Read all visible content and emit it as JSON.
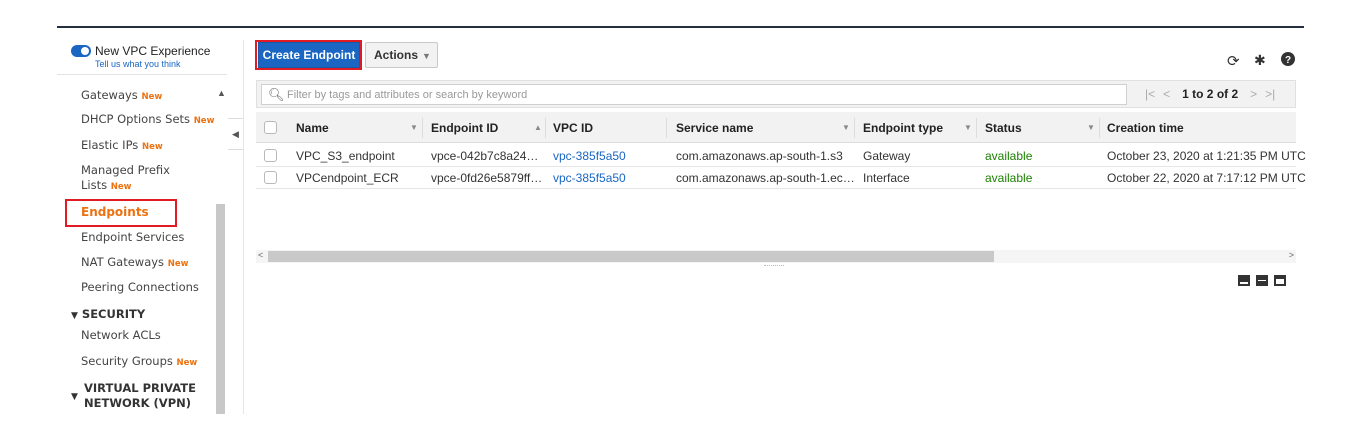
{
  "sidebar": {
    "vpc_experience": {
      "title": "New VPC Experience",
      "link": "Tell us what you think"
    },
    "items": [
      {
        "label": "Gateways",
        "badge": "New"
      },
      {
        "label": "DHCP Options Sets",
        "badge": "New"
      },
      {
        "label": "Elastic IPs",
        "badge": "New"
      },
      {
        "label": "Managed Prefix",
        "label2": "Lists",
        "badge": "New"
      },
      {
        "label": "Endpoints",
        "badge": ""
      },
      {
        "label": "Endpoint Services",
        "badge": ""
      },
      {
        "label": "NAT Gateways",
        "badge": "New"
      },
      {
        "label": "Peering Connections",
        "badge": ""
      }
    ],
    "sections": [
      {
        "label": "SECURITY",
        "items": [
          {
            "label": "Network ACLs",
            "badge": ""
          },
          {
            "label": "Security Groups",
            "badge": "New"
          }
        ]
      },
      {
        "label": "VIRTUAL PRIVATE",
        "label2": "NETWORK (VPN)"
      }
    ]
  },
  "toolbar": {
    "create_label": "Create Endpoint",
    "actions_label": "Actions",
    "icons": [
      "refresh-icon",
      "gear-icon",
      "help-icon"
    ]
  },
  "filter": {
    "placeholder": "Filter by tags and attributes or search by keyword",
    "pager": "1 to 2 of 2"
  },
  "table": {
    "columns": [
      "Name",
      "Endpoint ID",
      "VPC ID",
      "Service name",
      "Endpoint type",
      "Status",
      "Creation time"
    ],
    "rows": [
      [
        "VPC_S3_endpoint",
        "vpce-042b7c8a24…",
        "vpc-385f5a50",
        "com.amazonaws.ap-south-1.s3",
        "Gateway",
        "available",
        "October 23, 2020 at 1:21:35 PM UTC"
      ],
      [
        "VPCendpoint_ECR",
        "vpce-0fd26e5879ff…",
        "vpc-385f5a50",
        "com.amazonaws.ap-south-1.ec…",
        "Interface",
        "available",
        "October 22, 2020 at 7:17:12 PM UTC"
      ]
    ]
  },
  "colors": {
    "primary": "#1a66c2",
    "accent": "#ec7211",
    "highlight": "#e01b24",
    "status_ok": "#1d8102"
  }
}
